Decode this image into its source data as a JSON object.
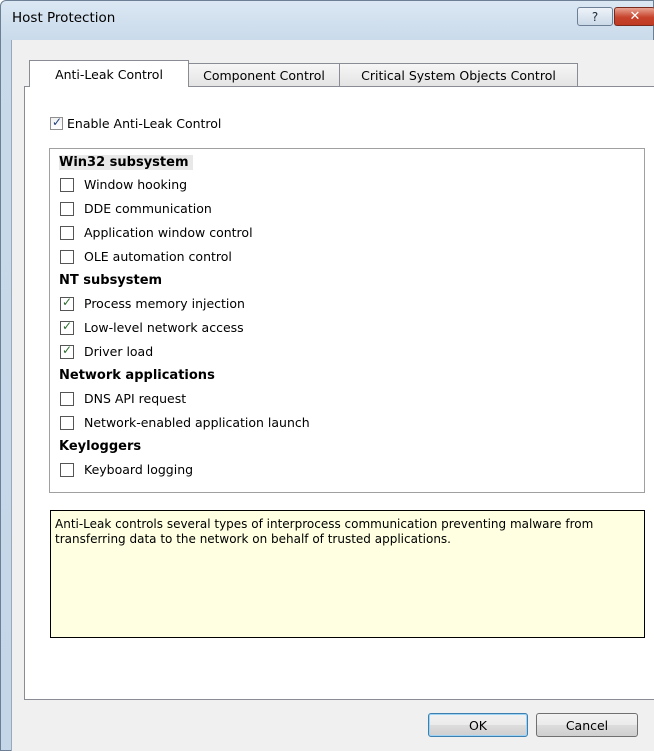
{
  "window": {
    "title": "Host Protection",
    "help_glyph": "?",
    "close_glyph": "✕"
  },
  "tabs": [
    {
      "label": "Anti-Leak Control",
      "active": true
    },
    {
      "label": "Component Control",
      "active": false
    },
    {
      "label": "Critical System Objects Control",
      "active": false
    }
  ],
  "enable": {
    "label": "Enable Anti-Leak Control",
    "checked": true
  },
  "groups": [
    {
      "title": "Win32 subsystem",
      "items": [
        {
          "label": "Window hooking",
          "checked": false
        },
        {
          "label": "DDE communication",
          "checked": false
        },
        {
          "label": "Application window control",
          "checked": false
        },
        {
          "label": "OLE automation control",
          "checked": false
        }
      ]
    },
    {
      "title": "NT subsystem",
      "items": [
        {
          "label": "Process memory injection",
          "checked": true
        },
        {
          "label": "Low-level network access",
          "checked": true
        },
        {
          "label": "Driver load",
          "checked": true
        }
      ]
    },
    {
      "title": "Network applications",
      "items": [
        {
          "label": "DNS API request",
          "checked": false
        },
        {
          "label": "Network-enabled application launch",
          "checked": false
        }
      ]
    },
    {
      "title": "Keyloggers",
      "items": [
        {
          "label": "Keyboard logging",
          "checked": false
        }
      ]
    }
  ],
  "description": "Anti-Leak controls several types of interprocess communication preventing malware from transferring data to the network on behalf of trusted applications.",
  "buttons": {
    "ok": "OK",
    "cancel": "Cancel"
  },
  "colors": {
    "description_bg": "#ffffe1",
    "close_button": "#c7432c",
    "titlebar": "#c9daea"
  }
}
